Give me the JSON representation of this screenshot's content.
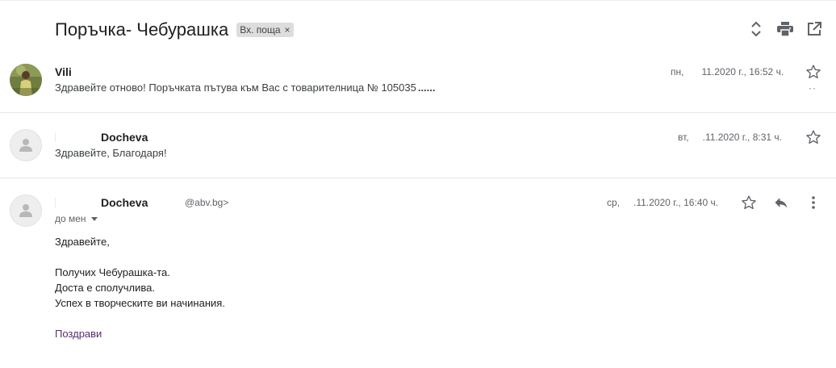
{
  "thread": {
    "subject": "Поръчка- Чебурашка",
    "label": "Вх. поща",
    "label_remove": "×"
  },
  "toolbar": {
    "icons": [
      "expand-collapse-icon",
      "print-icon",
      "open-new-window-icon"
    ]
  },
  "messages": [
    {
      "sender": "Vili",
      "snippet": "Здравейте отново! Поръчката пътува към Вас с товарителница № 105035",
      "snippet_trail": "......",
      "day": "пн,",
      "date": "11.2020 г., 16:52 ч.",
      "avatar": "photo"
    },
    {
      "sender": "Docheva",
      "snippet": "Здравейте, Благодаря!",
      "day": "вт,",
      "date": ".11.2020 г., 8:31 ч.",
      "avatar": "default"
    },
    {
      "sender": "Docheva",
      "email": "@abv.bg>",
      "to": "до мен",
      "day": "ср,",
      "date": ".11.2020 г., 16:40 ч.",
      "avatar": "default",
      "body": {
        "greeting": "Здравейте,",
        "line1": "Получих Чебурашка-та.",
        "line2": "Доста е сполучлива.",
        "line3": "Успех в творческите ви начинания.",
        "signature": "Поздрави"
      }
    }
  ]
}
